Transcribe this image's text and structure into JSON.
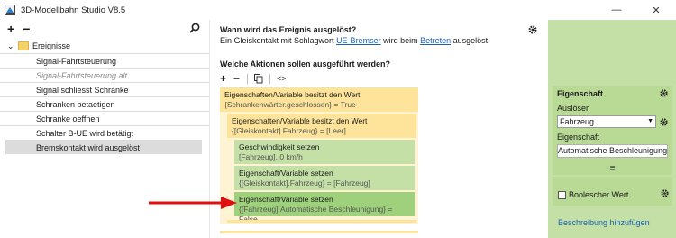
{
  "window": {
    "title": "3D-Modellbahn Studio V8.5",
    "icon": "app-icon",
    "minimize": "—",
    "close": "✕"
  },
  "left": {
    "add_icon": "+",
    "remove_icon": "−",
    "search_icon": "search-icon",
    "root": {
      "chevron": "⌄",
      "label": "Ereignisse"
    },
    "items": [
      {
        "label": "Signal-Fahrtsteuerung",
        "disabled": false,
        "selected": false
      },
      {
        "label": "Signal-Fahrtsteuerung alt",
        "disabled": true,
        "selected": false
      },
      {
        "label": "Signal schliesst Schranke",
        "disabled": false,
        "selected": false
      },
      {
        "label": "Schranken betaetigen",
        "disabled": false,
        "selected": false
      },
      {
        "label": "Schranke oeffnen",
        "disabled": false,
        "selected": false
      },
      {
        "label": "Schalter B-UE wird betätigt",
        "disabled": false,
        "selected": false
      },
      {
        "label": "Bremskontakt wird ausgelöst",
        "disabled": false,
        "selected": true
      }
    ]
  },
  "middle": {
    "question1": "Wann wird das Ereignis ausgelöst?",
    "desc_prefix": "Ein Gleiskontakt mit Schlagwort ",
    "desc_link1": "UE-Bremser",
    "desc_mid": " wird beim ",
    "desc_link2": "Betreten",
    "desc_suffix": " ausgelöst.",
    "question2": "Welche Aktionen sollen ausgeführt werden?",
    "toolbar": {
      "add": "+",
      "remove": "−",
      "copy_icon": "copy-icon",
      "code": "<>"
    },
    "actions": [
      {
        "title": "Eigenschaften/Variable besitzt den Wert",
        "sub": "{Schrankenwärter.geschlossen} = True"
      },
      {
        "title": "Eigenschaften/Variable besitzt den Wert",
        "sub": "{[Gleiskontakt].Fahrzeug} = [Leer]"
      },
      {
        "title": "Geschwindigkeit setzen",
        "sub": "[Fahrzeug], 0 km/h"
      },
      {
        "title": "Eigenschaft/Variable setzen",
        "sub": "{[Gleiskontakt].Fahrzeug} = [Fahrzeug]"
      },
      {
        "title": "Eigenschaft/Variable setzen",
        "sub": "{[Fahrzeug].Automatische Beschleunigung} = False"
      }
    ]
  },
  "right": {
    "header": "Eigenschaft",
    "trigger_label": "Auslöser",
    "trigger_value": "Fahrzeug",
    "property_label": "Eigenschaft",
    "property_value": "Automatische Beschleunigung",
    "equals": "=",
    "bool_label": "Boolescher Wert",
    "add_desc": "Beschreibung hinzufügen"
  },
  "colors": {
    "yellow": "#fde49a",
    "green": "#c4e0a7",
    "green_selected": "#9fd17c",
    "arrow": "#e01010"
  }
}
